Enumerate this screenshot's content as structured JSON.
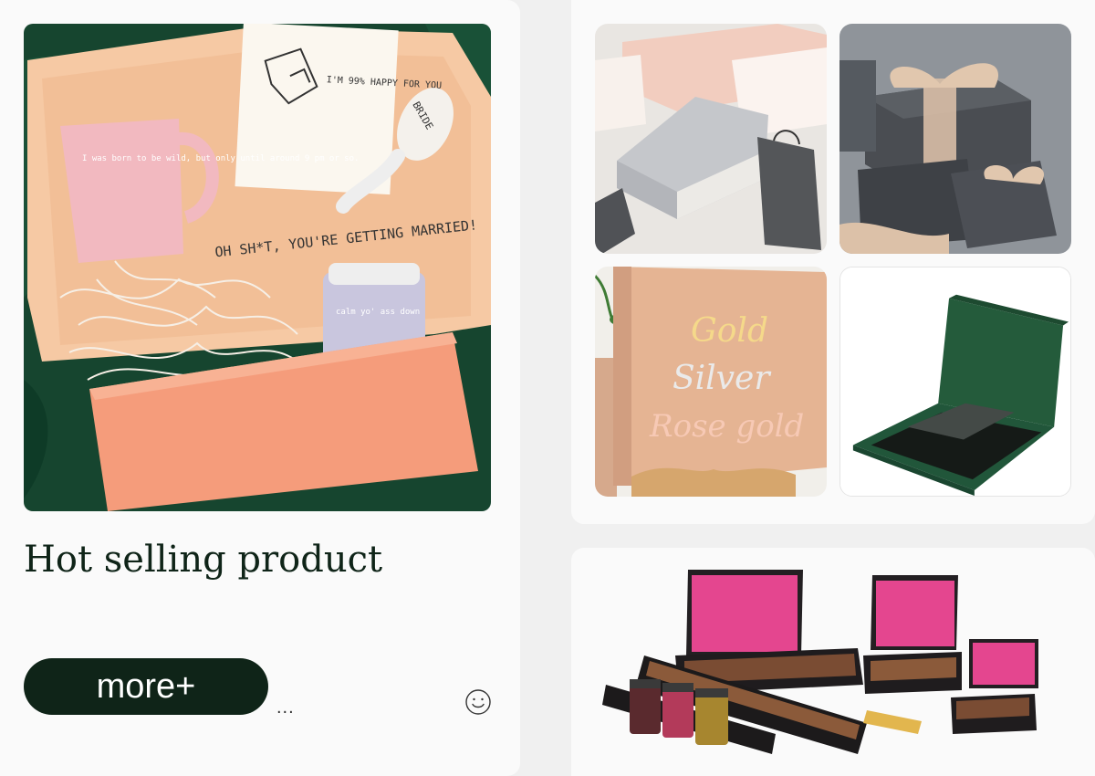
{
  "hero": {
    "mug_text": "I was born to be wild, but only until around 9 pm or so.",
    "card_text": "I'M 99% HAPPY FOR YOU",
    "balloon_text": "BRIDE",
    "box_text": "OH SH*T, YOU'RE GETTING MARRIED!",
    "candle_text": "calm yo' ass down"
  },
  "foil_box": {
    "line1": "Gold",
    "line2": "Silver",
    "line3": "Rose gold"
  },
  "section": {
    "title": "Hot selling product",
    "more_label": "more+",
    "ellipsis": "...",
    "icon": "smile-icon"
  },
  "colors": {
    "dark_green": "#0f2418",
    "panel": "#fafafa",
    "background": "#f0f0f0"
  }
}
